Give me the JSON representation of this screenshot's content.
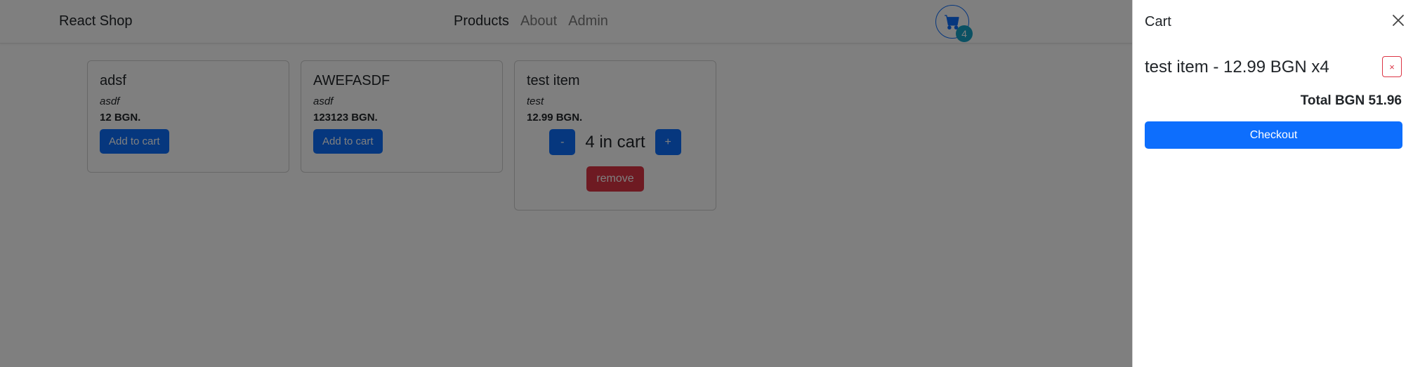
{
  "navbar": {
    "brand": "React Shop",
    "links": [
      "Products",
      "About",
      "Admin"
    ],
    "active_link": "Products",
    "cart_count": "4"
  },
  "products": [
    {
      "title": "adsf",
      "description": "asdf",
      "price": "12 BGN.",
      "button": "Add to cart"
    },
    {
      "title": "AWEFASDF",
      "description": "asdf",
      "price": "123123 BGN.",
      "button": "Add to cart"
    },
    {
      "title": "test item",
      "description": "test",
      "price": "12.99 BGN.",
      "decrement": "-",
      "quantity_text": "4 in cart",
      "increment": "+",
      "remove": "remove"
    }
  ],
  "cart": {
    "title": "Cart",
    "close_icon": "close-icon",
    "items": [
      {
        "text": "test item - 12.99 BGN x4",
        "remove": "×"
      }
    ],
    "total": "Total BGN 51.96",
    "checkout": "Checkout"
  },
  "colors": {
    "primary": "#0d6efd",
    "danger": "#dc3545",
    "badge": "#17a2c7",
    "backdrop": "rgba(0,0,0,0.5)"
  }
}
